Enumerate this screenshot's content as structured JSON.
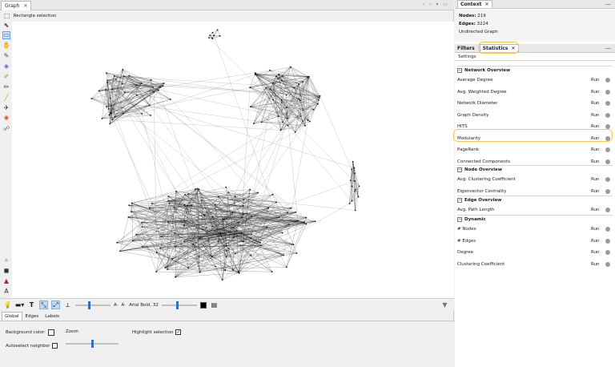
{
  "graph_window": {
    "tab_label": "Graph",
    "tool_label": "Rectangle selection",
    "font_label": "Arial Bold, 32"
  },
  "bottom_toolbar": {
    "text_A1": "A·",
    "text_A2": "A·"
  },
  "properties": {
    "tabs": [
      "Global",
      "Edges",
      "Labels"
    ],
    "background_color_label": "Background color:",
    "zoom_label": "Zoom",
    "highlight_selection_label": "Highlight selection",
    "highlight_selection_checked": "✓",
    "autoselect_neighbor_label": "Autoselect neighbor"
  },
  "context": {
    "tab_label": "Context",
    "nodes_label": "Nodes:",
    "nodes_value": "219",
    "edges_label": "Edges:",
    "edges_value": "3224",
    "graph_type": "Undirected Graph"
  },
  "stats_panel": {
    "filters_tab": "Filters",
    "statistics_tab": "Statistics",
    "settings_label": "Settings",
    "run_label": "Run",
    "sections": {
      "network_overview": "Network Overview",
      "node_overview": "Node Overview",
      "edge_overview": "Edge Overview",
      "dynamic": "Dynamic"
    },
    "network_items": [
      "Average Degree",
      "Avg. Weighted Degree",
      "Network Diameter",
      "Graph Density",
      "HITS",
      "Modularity",
      "PageRank",
      "Connected Components"
    ],
    "node_items": [
      "Avg. Clustering Coefficient",
      "Eigenvector Centrality"
    ],
    "edge_items": [
      "Avg. Path Length"
    ],
    "dynamic_items": [
      "# Nodes",
      "# Edges",
      "Degree",
      "Clustering Coefficient"
    ]
  },
  "colors": {
    "highlight": "#f2c94c",
    "selected_tool": "#cfe3f7"
  }
}
